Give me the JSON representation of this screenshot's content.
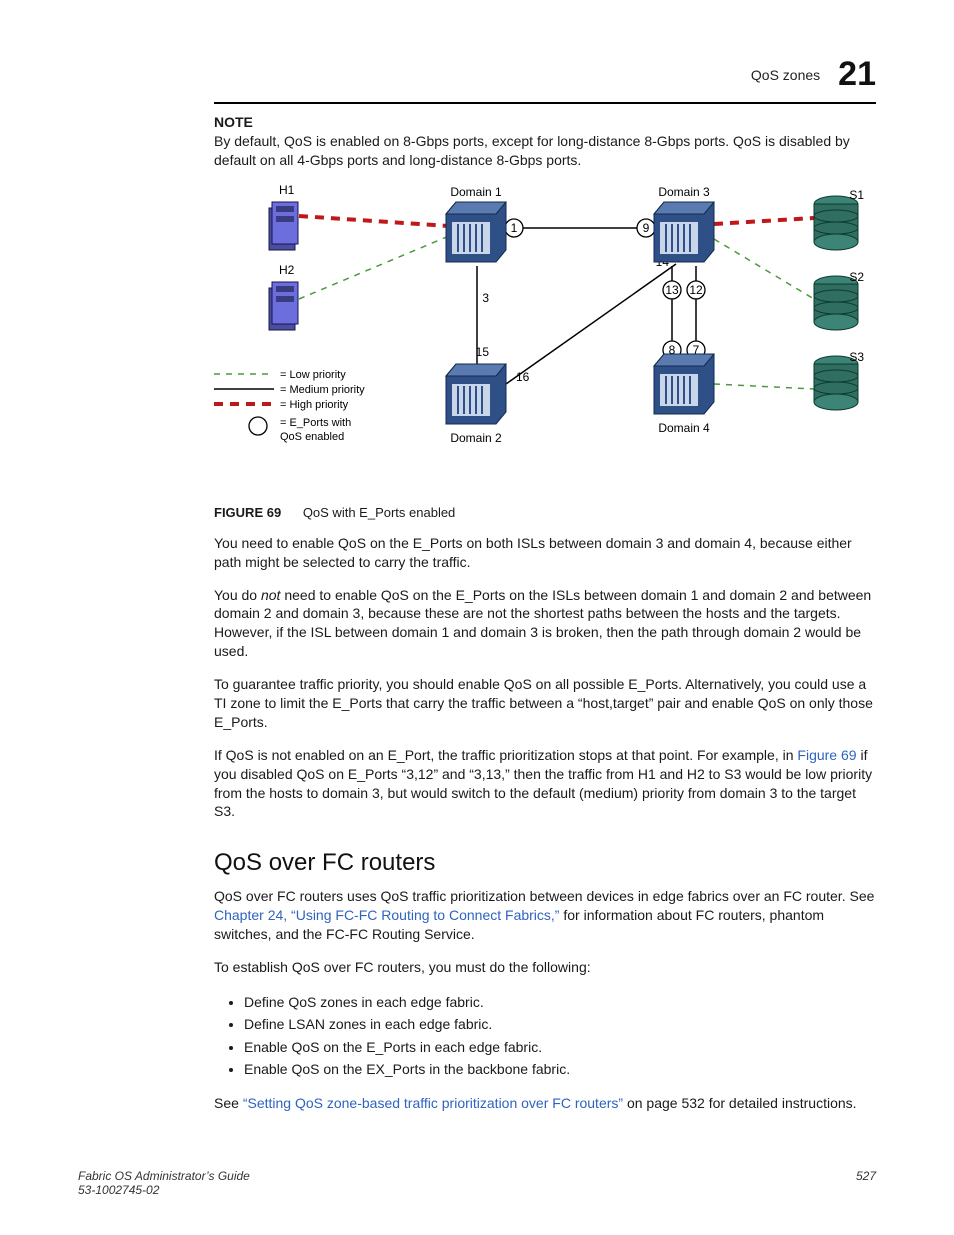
{
  "running_header": {
    "text": "QoS zones",
    "chapter_number": "21"
  },
  "note": {
    "label": "NOTE",
    "body": "By default, QoS is enabled on 8-Gbps ports, except for long-distance 8-Gbps ports. QoS is disabled by default on all 4-Gbps ports and long-distance 8-Gbps ports."
  },
  "figure": {
    "number_label": "FIGURE 69",
    "caption": "QoS with E_Ports enabled",
    "node_labels": {
      "h1": "H1",
      "h2": "H2",
      "d1": "Domain 1",
      "d2": "Domain 2",
      "d3": "Domain 3",
      "d4": "Domain 4",
      "s1": "S1",
      "s2": "S2",
      "s3": "S3"
    },
    "port_labels": {
      "p1": "1",
      "p3": "3",
      "p15": "15",
      "p16": "16",
      "p9": "9",
      "p14": "14",
      "p12": "12",
      "p13": "13",
      "p7": "7",
      "p8": "8"
    },
    "legend": {
      "low": "= Low priority",
      "med": "= Medium priority",
      "high": "= High priority",
      "eport": "= E_Ports with",
      "eport2": "QoS enabled"
    }
  },
  "para1": "You need to enable QoS on the E_Ports on both ISLs between domain 3 and domain 4, because either path might be selected to carry the traffic.",
  "para2_a": "You do ",
  "para2_not": "not",
  "para2_b": " need to enable QoS on the E_Ports on the ISLs between domain 1 and domain 2 and between domain 2 and domain 3, because these are not the shortest paths between the hosts and the targets. However, if the ISL between domain 1 and domain 3 is broken, then the path through domain 2 would be used.",
  "para3": "To guarantee traffic priority, you should enable QoS on all possible E_Ports. Alternatively, you could use a TI zone to limit the E_Ports that carry the traffic between a “host,target” pair and enable QoS on only those E_Ports.",
  "para4_a": "If QoS is not enabled on an E_Port, the traffic prioritization stops at that point. For example, in ",
  "para4_link": "Figure 69",
  "para4_b": " if you disabled QoS on E_Ports “3,12” and “3,13,” then the traffic from H1 and H2 to S3 would be low priority from the hosts to domain 3, but would switch to the default (medium) priority from domain 3 to the target S3.",
  "section_heading": "QoS over FC routers",
  "para5_a": "QoS over FC routers uses QoS traffic prioritization between devices in edge fabrics over an FC router. See ",
  "para5_link": "Chapter 24, “Using FC-FC Routing to Connect Fabrics,”",
  "para5_b": " for information about FC routers, phantom switches, and the FC-FC Routing Service.",
  "para6": "To establish QoS over FC routers, you must do the following:",
  "bullets": [
    "Define QoS zones in each edge fabric.",
    "Define LSAN zones in each edge fabric.",
    "Enable QoS on the E_Ports in each edge fabric.",
    "Enable QoS on the EX_Ports in the backbone fabric."
  ],
  "para7_a": "See ",
  "para7_link": "“Setting QoS zone-based traffic prioritization over FC routers”",
  "para7_b": " on page 532 for detailed instructions.",
  "footer": {
    "left1": "Fabric OS Administrator’s Guide",
    "left2": "53-1002745-02",
    "page": "527"
  }
}
